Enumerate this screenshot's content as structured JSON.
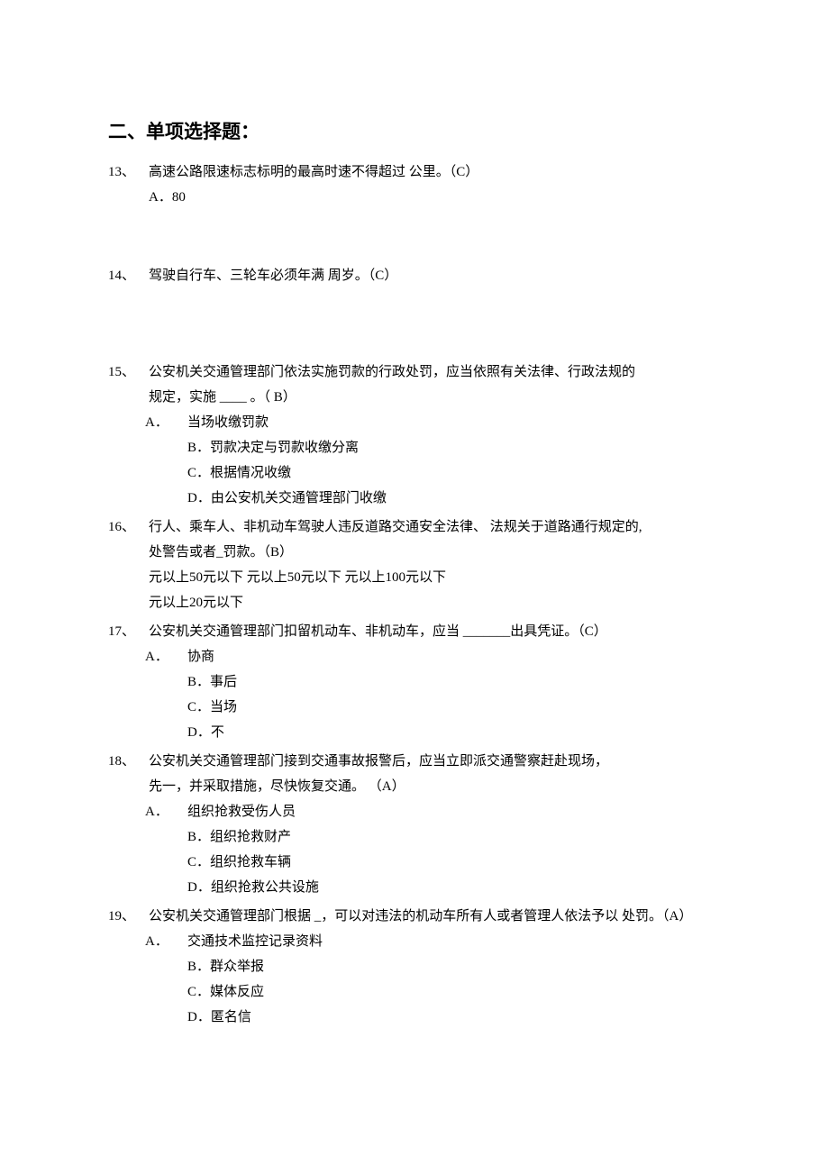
{
  "section_title": "二、单项选择题：",
  "q13": {
    "num": "13、",
    "text": "高速公路限速标志标明的最高时速不得超过   公里。（C）",
    "optA_label": "A．",
    "optA_text": "80"
  },
  "q14": {
    "num": "14、",
    "text": "驾驶自行车、三轮车必须年满           周岁。（C）"
  },
  "q15": {
    "num": "15、",
    "text": "公安机关交通管理部门依法实施罚款的行政处罚，应当依照有关法律、行政法规的",
    "text2": "规定，实施 ____ 。（ B）",
    "optA_label": "A．",
    "optA_text": "当场收缴罚款",
    "optB": "B．罚款决定与罚款收缴分离",
    "optC": "C．根据情况收缴",
    "optD": "D．由公安机关交通管理部门收缴"
  },
  "q16": {
    "num": "16、",
    "text": "行人、乘车人、非机动车驾驶人违反道路交通安全法律、        法规关于道路通行规定的,",
    "text2": "处警告或者_罚款。（B）",
    "line3": "元以上50元以下  元以上50元以下  元以上100元以下",
    "line4": "元以上20元以下"
  },
  "q17": {
    "num": "17、",
    "text": "公安机关交通管理部门扣留机动车、非机动车，应当   _______出具凭证。（C）",
    "optA_label": "A．",
    "optA_text": "协商",
    "optB": "B．事后",
    "optC": "C．当场",
    "optD": "D．不"
  },
  "q18": {
    "num": "18、",
    "text": "公安机关交通管理部门接到交通事故报警后，应当立即派交通警察赶赴现场，",
    "text2": "先一，并采取措施，尽快恢复交通。        （A）",
    "optA_label": "A．",
    "optA_text": "组织抢救受伤人员",
    "optB": "B．组织抢救财产",
    "optC": "C．组织抢救车辆",
    "optD": "D．组织抢救公共设施"
  },
  "q19": {
    "num": "19、",
    "text": "公安机关交通管理部门根据 _，可以对违法的机动车所有人或者管理人依法予以 处罚。（A）",
    "optA_label": "A．",
    "optA_text": "交通技术监控记录资料",
    "optB": "B．群众举报",
    "optC": "C．媒体反应",
    "optD": "D．匿名信"
  }
}
